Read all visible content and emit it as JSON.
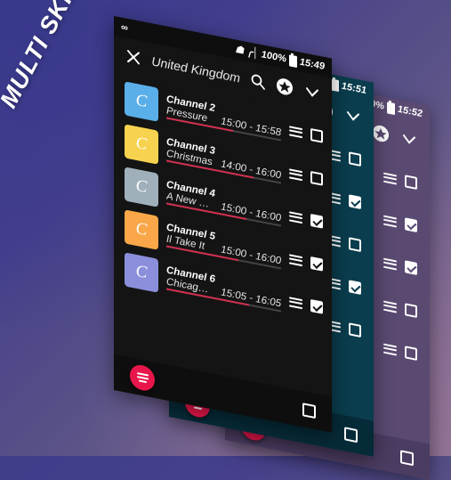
{
  "promo": {
    "text": "MULTI SKINS"
  },
  "theme": {
    "accent": "#e8164a",
    "dark_panel": "#141414",
    "teal_panel": "#0a3d4d",
    "purple_panel": "#5a4a72",
    "progress_color": "#d32f4f"
  },
  "panels": [
    {
      "id": "dark",
      "status": {
        "left_icon": "infinity-icon",
        "wifi": "wifi-icon",
        "signal": "signal-icon",
        "battery_text": "100%",
        "battery_icon": "battery-icon",
        "clock": "15:49"
      },
      "appbar": {
        "close": "close-icon",
        "title": "United Kingdom",
        "search": "search-icon",
        "favorite": "star-icon",
        "expand": "chevron-down-icon"
      },
      "rows": [
        {
          "avatar_letter": "C",
          "avatar_color": "#5bafe8",
          "channel": "Channel 2",
          "program": "Pressure",
          "time": "15:00 - 15:58",
          "progress": 58,
          "checked": false
        },
        {
          "avatar_letter": "C",
          "avatar_color": "#f7d24e",
          "channel": "Channel 3",
          "program": "Christmas",
          "time": "14:00 - 16:00",
          "progress": 76,
          "checked": false
        },
        {
          "avatar_letter": "C",
          "avatar_color": "#9fb0bb",
          "channel": "Channel 4",
          "program": "A New Life",
          "time": "15:00 - 16:00",
          "progress": 70,
          "checked": true
        },
        {
          "avatar_letter": "C",
          "avatar_color": "#f9a748",
          "channel": "Channel 5",
          "program": "Il Take It",
          "time": "15:00 - 16:00",
          "progress": 63,
          "checked": true
        },
        {
          "avatar_letter": "C",
          "avatar_color": "#8b8fdb",
          "channel": "Channel 6",
          "program": "Chicago PD",
          "time": "15:05 - 16:05",
          "progress": 72,
          "checked": true
        }
      ],
      "bottom": {
        "fab": "menu-fab",
        "square": "stop-icon"
      }
    },
    {
      "id": "teal",
      "status": {
        "signal": "signal-icon",
        "battery_text": "100%",
        "battery_icon": "battery-icon",
        "clock": "15:51"
      },
      "appbar": {
        "favorite": "star-icon",
        "expand": "chevron-down-icon"
      },
      "rows": [
        {
          "checked": false
        },
        {
          "checked": true
        },
        {
          "checked": false
        },
        {
          "checked": true
        },
        {
          "checked": false
        }
      ],
      "bottom": {
        "fab": "menu-fab",
        "square": "stop-icon"
      }
    },
    {
      "id": "purple",
      "status": {
        "battery_text": "100%",
        "battery_icon": "battery-icon",
        "clock": "15:52"
      },
      "appbar": {
        "favorite": "star-icon",
        "expand": "chevron-down-icon"
      },
      "rows": [
        {
          "checked": false
        },
        {
          "checked": true
        },
        {
          "checked": true
        },
        {
          "checked": false
        },
        {
          "checked": false
        }
      ],
      "bottom": {
        "fab": "menu-fab",
        "square": "stop-icon"
      }
    }
  ]
}
